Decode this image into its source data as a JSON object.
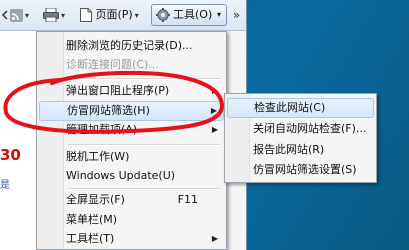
{
  "toolbar": {
    "page_label": "页面(P)",
    "tools_label": "工具(O)",
    "more_label": "»"
  },
  "page_fragment": {
    "red_text": "30",
    "blue_text": "是"
  },
  "tools_menu": {
    "items": [
      {
        "label": "删除浏览的历史记录(D)...",
        "enabled": true
      },
      {
        "label": "诊断连接问题(C)...",
        "enabled": false
      },
      {
        "label": "弹出窗口阻止程序(P)",
        "enabled": true
      },
      {
        "label": "仿冒网站筛选(H)",
        "enabled": true,
        "submenu": true,
        "highlighted": true
      },
      {
        "label": "管理加载项(A)",
        "enabled": true
      },
      {
        "label": "脱机工作(W)",
        "enabled": true
      },
      {
        "label": "Windows Update(U)",
        "enabled": true
      },
      {
        "label": "全屏显示(F)",
        "enabled": true,
        "shortcut": "F11"
      },
      {
        "label": "菜单栏(M)",
        "enabled": true
      },
      {
        "label": "工具栏(T)",
        "enabled": true,
        "submenu": true
      }
    ]
  },
  "phishing_submenu": {
    "items": [
      {
        "label": "检查此网站(C)",
        "highlighted": true
      },
      {
        "label": "关闭自动网站检查(F)..."
      },
      {
        "label": "报告此网站(R)"
      },
      {
        "label": "仿冒网站筛选设置(S)"
      }
    ]
  },
  "colors": {
    "annotation": "#e8101a",
    "desktop": "#0b6298",
    "highlight": "#d4e6fb"
  }
}
